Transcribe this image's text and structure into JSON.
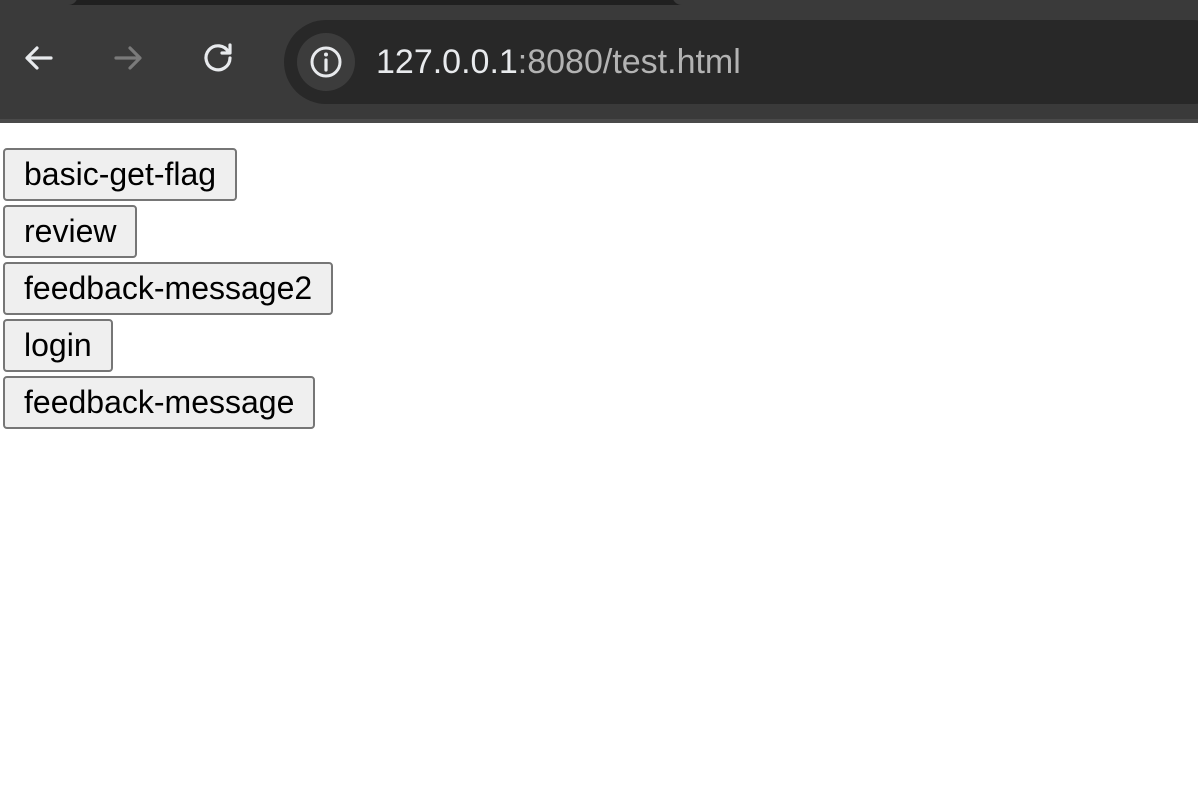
{
  "browser": {
    "url_host": "127.0.0.1",
    "url_rest": ":8080/test.html",
    "colors": {
      "chrome_bg": "#3a3a3a",
      "omnibox_bg": "#282828",
      "icon_active": "#e8eaed",
      "icon_disabled": "#7a7a7a"
    },
    "icons": {
      "back": "arrow-left",
      "forward": "arrow-right",
      "reload": "reload",
      "site_info": "info-circle"
    }
  },
  "page": {
    "buttons": [
      {
        "label": "basic-get-flag"
      },
      {
        "label": "review"
      },
      {
        "label": "feedback-message2"
      },
      {
        "label": "login"
      },
      {
        "label": "feedback-message"
      }
    ]
  }
}
